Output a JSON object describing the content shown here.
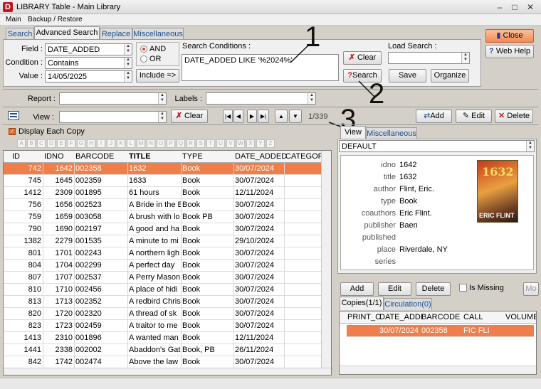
{
  "window": {
    "title": "LIBRARY Table - Main Library",
    "app_letter": "D",
    "minimize": "–",
    "maximize": "□",
    "close": "✕"
  },
  "menu": {
    "items": [
      "Main",
      "Backup / Restore"
    ]
  },
  "tabs": [
    "Search",
    "Advanced Search",
    "Replace",
    "Miscellaneous"
  ],
  "search": {
    "field_label": "Field :",
    "field_value": "DATE_ADDED",
    "condition_label": "Condition :",
    "condition_value": "Contains",
    "value_label": "Value :",
    "value_value": "14/05/2025",
    "and_label": "AND",
    "or_label": "OR",
    "include_label": "Include =>",
    "conditions_label": "Search Conditions :",
    "conditions_text": "DATE_ADDED LIKE '%2024%'",
    "clear_label": "Clear",
    "search_label": "Search",
    "load_search_label": "Load Search :",
    "load_search_value": "",
    "save_label": "Save",
    "organize_label": "Organize",
    "close_label": "Close",
    "webhelp_label": "Web Help"
  },
  "report": {
    "report_label": "Report :",
    "labels_label": "Labels :",
    "report_value": "",
    "labels_value": ""
  },
  "view_bar": {
    "view_label": "View :",
    "view_value": "",
    "clear_label": "Clear",
    "record_pos": "1/339",
    "add_label": "Add",
    "edit_label": "Edit",
    "delete_label": "Delete"
  },
  "display_each_copy": "Display Each Copy",
  "alphabet": [
    "A",
    "B",
    "C",
    "D",
    "E",
    "F",
    "G",
    "H",
    "I",
    "J",
    "K",
    "L",
    "M",
    "N",
    "O",
    "P",
    "Q",
    "R",
    "S",
    "T",
    "U",
    "V",
    "W",
    "X",
    "Y",
    "Z"
  ],
  "table": {
    "columns": [
      "ID",
      "IDNO",
      "BARCODE",
      "TITLE",
      "TYPE",
      "DATE_ADDED",
      "CATEGOR"
    ],
    "rows": [
      [
        "742",
        "1642",
        "002358",
        "1632",
        "Book",
        "30/07/2024"
      ],
      [
        "745",
        "1645",
        "002359",
        "1633",
        "Book",
        "30/07/2024"
      ],
      [
        "1412",
        "2309",
        "001895",
        "61 hours",
        "Book",
        "12/11/2024"
      ],
      [
        "756",
        "1656",
        "002523",
        "A Bride in the B",
        "Book",
        "30/07/2024"
      ],
      [
        "759",
        "1659",
        "003058",
        "A brush with lo",
        "Book PB",
        "30/07/2024"
      ],
      [
        "790",
        "1690",
        "002197",
        "A good and ha",
        "Book",
        "30/07/2024"
      ],
      [
        "1382",
        "2279",
        "001535",
        "A minute to mi",
        "Book",
        "29/10/2024"
      ],
      [
        "801",
        "1701",
        "002243",
        "A northern ligh",
        "Book",
        "30/07/2024"
      ],
      [
        "804",
        "1704",
        "002299",
        "A perfect day",
        "Book",
        "30/07/2024"
      ],
      [
        "807",
        "1707",
        "002537",
        "A Perry Mason",
        "Book",
        "30/07/2024"
      ],
      [
        "810",
        "1710",
        "002456",
        "A place of hidi",
        "Book",
        "30/07/2024"
      ],
      [
        "813",
        "1713",
        "002352",
        "A redbird Chris",
        "Book",
        "30/07/2024"
      ],
      [
        "820",
        "1720",
        "002320",
        "A thread of sk",
        "Book",
        "30/07/2024"
      ],
      [
        "823",
        "1723",
        "002459",
        "A traitor to me",
        "Book",
        "30/07/2024"
      ],
      [
        "1413",
        "2310",
        "001896",
        "A wanted man",
        "Book",
        "12/11/2024"
      ],
      [
        "1441",
        "2338",
        "002002",
        "Abaddon's Gat",
        "Book, PB",
        "26/11/2024"
      ],
      [
        "842",
        "1742",
        "002474",
        "Above the law",
        "Book",
        "30/07/2024"
      ]
    ]
  },
  "right_tabs": [
    "View",
    "Miscellaneous"
  ],
  "view_select": "DEFAULT",
  "details": [
    {
      "label": "idno",
      "value": "1642"
    },
    {
      "label": "title",
      "value": "1632"
    },
    {
      "label": "author",
      "value": "Flint, Eric."
    },
    {
      "label": "type",
      "value": "Book"
    },
    {
      "label": "coauthors",
      "value": "Eric Flint."
    },
    {
      "label": "publisher",
      "value": "Baen"
    },
    {
      "label": "published",
      "value": ""
    },
    {
      "label": "place",
      "value": "Riverdale, NY"
    },
    {
      "label": "series",
      "value": ""
    }
  ],
  "cover": {
    "title": "1632",
    "author": "ERIC FLINT"
  },
  "copy_actions": {
    "add": "Add",
    "edit": "Edit",
    "delete": "Delete",
    "is_missing": "Is Missing",
    "more": "Mo"
  },
  "copy_tabs": [
    "Copies(1/1)",
    "Circulation(0)"
  ],
  "copies": {
    "columns": [
      "PRINT_C",
      "DATE_ADDI",
      "BARCODE",
      "CALL",
      "VOLUME"
    ],
    "rows": [
      [
        "",
        "30/07/2024",
        "002358",
        "FIC FLI",
        ""
      ]
    ]
  },
  "callouts": [
    "1",
    "2",
    "3"
  ]
}
